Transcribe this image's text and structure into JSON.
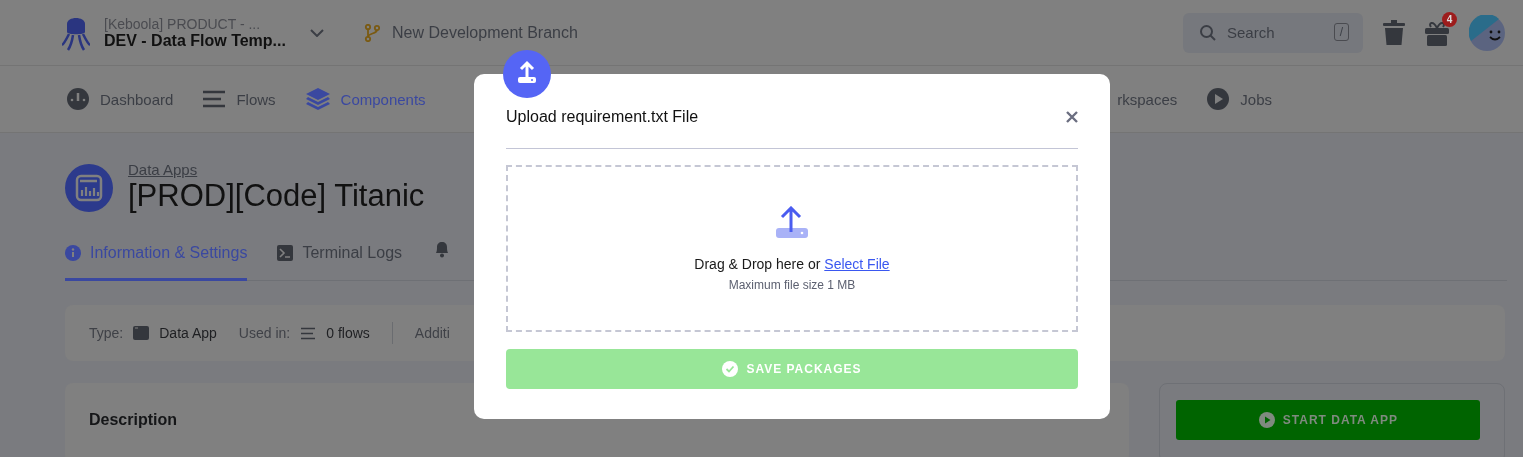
{
  "header": {
    "project": {
      "organization": "[Keboola] PRODUCT - ...",
      "name": "DEV - Data Flow Temp..."
    },
    "branch": "New Development Branch",
    "search": {
      "placeholder": "Search",
      "shortcut": "/"
    },
    "notifications": "4"
  },
  "nav": [
    {
      "label": "Dashboard",
      "kind": "dashboard",
      "selected": false
    },
    {
      "label": "Flows",
      "kind": "flows",
      "selected": false
    },
    {
      "label": "Components",
      "kind": "components",
      "selected": true
    },
    {
      "label": "rkspaces",
      "kind": "cut",
      "selected": false
    },
    {
      "label": "Jobs",
      "kind": "jobs",
      "selected": false
    }
  ],
  "page": {
    "breadcrumb": "Data Apps",
    "title": "[PROD][Code] Titanic"
  },
  "tabs": [
    {
      "label": "Information & Settings",
      "kind": "info",
      "selected": true
    },
    {
      "label": "Terminal Logs",
      "kind": "terminal",
      "selected": false
    }
  ],
  "info_bar": {
    "type_label": "Type:",
    "type_value": "Data App",
    "used_label": "Used in:",
    "used_value": "0 flows",
    "more": "Additi"
  },
  "description": {
    "title": "Description"
  },
  "start_button": {
    "label": "START DATA APP"
  },
  "modal": {
    "title": "Upload requirement.txt File",
    "drop_text": "Drag & Drop here or",
    "link": "Select File",
    "hint": "Maximum file size 1 MB",
    "save": {
      "label": "SAVE PACKAGES",
      "disabled": true
    }
  }
}
